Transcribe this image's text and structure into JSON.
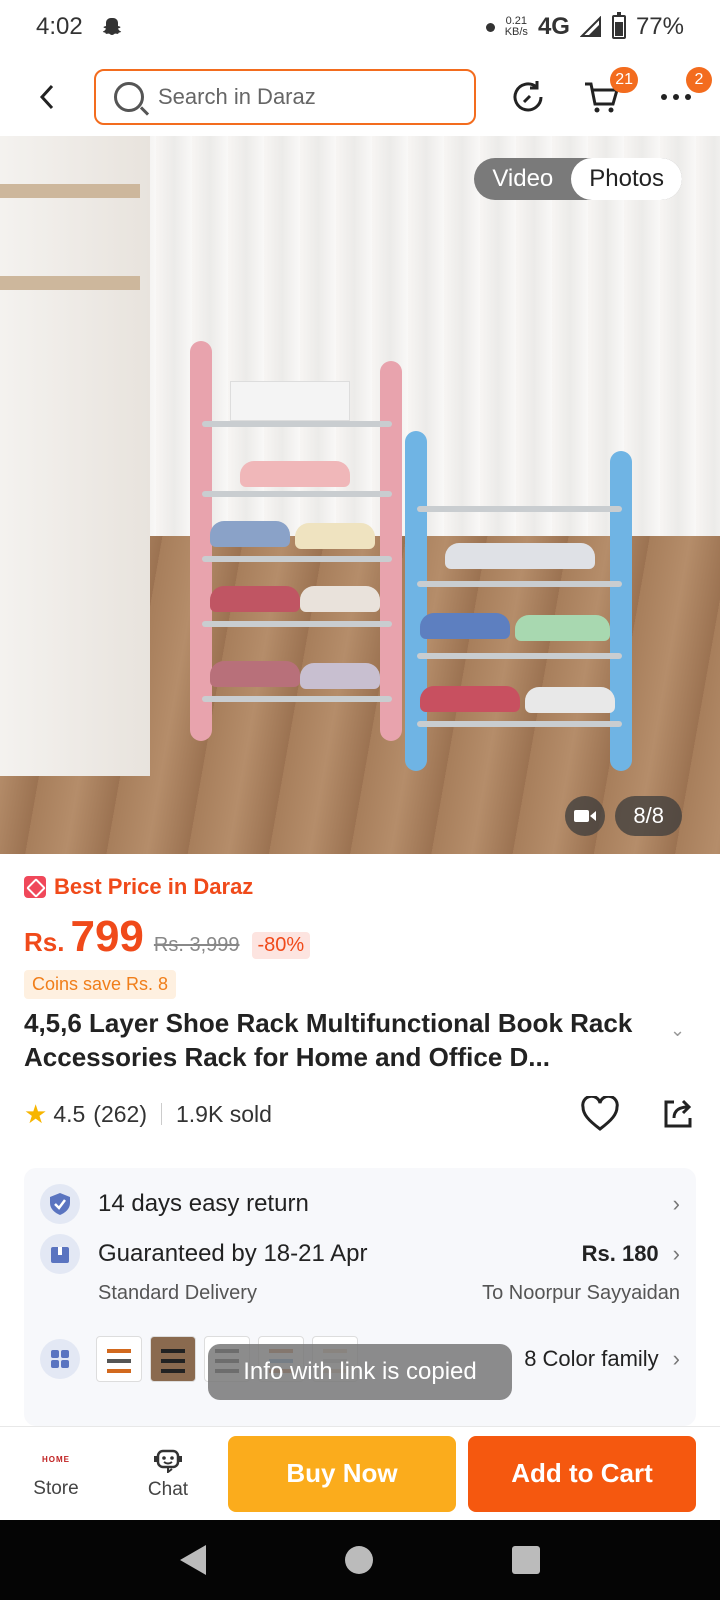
{
  "status_bar": {
    "time": "4:02",
    "kbs_top": "0.21",
    "kbs_bottom": "KB/s",
    "network": "4G",
    "battery": "77%"
  },
  "header": {
    "search_placeholder": "Search in Daraz",
    "cart_badge": "21",
    "more_badge": "2"
  },
  "gallery": {
    "video_label": "Video",
    "photos_label": "Photos",
    "page_indicator": "8/8"
  },
  "product": {
    "best_price_label": "Best Price in Daraz",
    "currency": "Rs.",
    "price": "799",
    "original_price": "Rs. 3,999",
    "discount": "-80%",
    "coins": "Coins save Rs. 8",
    "title": "4,5,6 Layer Shoe Rack Multifunctional Book Rack Accessories Rack for Home and Office D...",
    "rating": "4.5",
    "reviews": "(262)",
    "sold": "1.9K sold"
  },
  "services": {
    "return_label": "14 days easy return",
    "delivery_label": "Guaranteed by 18-21 Apr",
    "delivery_price": "Rs. 180",
    "delivery_type": "Standard Delivery",
    "delivery_location": "To Noorpur Sayyaidan",
    "color_family": "8 Color family"
  },
  "toast": "Info with link is copied",
  "bottom_bar": {
    "store_logo": "HOME",
    "store_label": "Store",
    "chat_label": "Chat",
    "buy_now": "Buy Now",
    "add_to_cart": "Add to Cart"
  },
  "colors": {
    "accent": "#f36c1e",
    "price": "#f04a1a",
    "buy_now": "#fbac1c",
    "add_to_cart": "#f5580f"
  }
}
